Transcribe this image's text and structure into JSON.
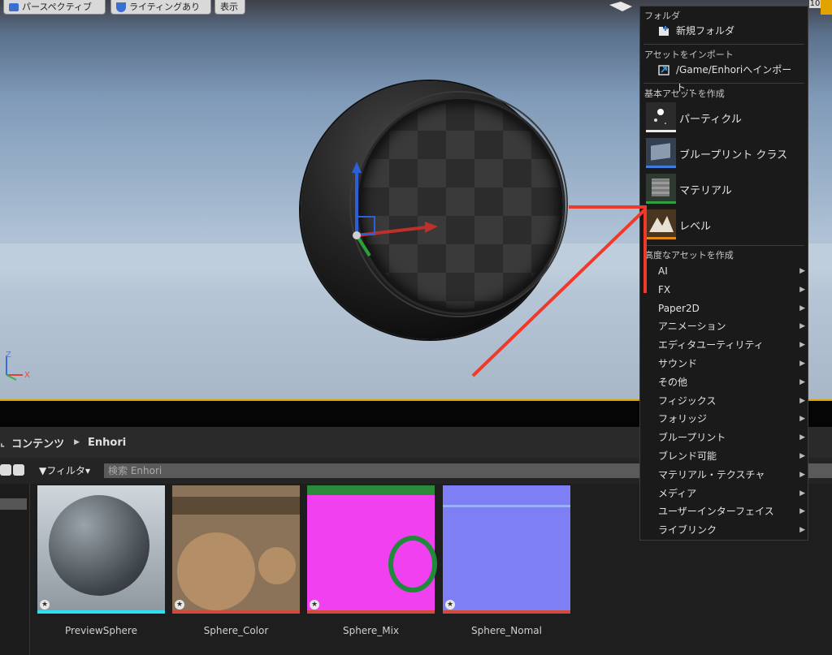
{
  "viewport": {
    "buttons": {
      "perspective": "パースペクティブ",
      "lighting": "ライティングあり",
      "show": "表示"
    },
    "axes": {
      "z": "Z",
      "x": "X"
    },
    "corner_number": "10"
  },
  "content_browser": {
    "breadcrumb": {
      "root": "コンテンツ",
      "folder": "Enhori"
    },
    "filter_label": "▼フィルタ▾",
    "search_placeholder": "検索 Enhori",
    "assets": [
      {
        "name": "PreviewSphere",
        "bar_color": "#2de0f0"
      },
      {
        "name": "Sphere_Color",
        "bar_color": "#d24a3a"
      },
      {
        "name": "Sphere_Mix",
        "bar_color": "#d24a3a"
      },
      {
        "name": "Sphere_Nomal",
        "bar_color": "#d24a3a"
      }
    ]
  },
  "menu": {
    "sections": {
      "folder": "フォルダ",
      "import": "アセットをインポート",
      "basic": "基本アセットを作成",
      "advanced": "高度なアセットを作成"
    },
    "new_folder": "新規フォルダ",
    "import_path": "/Game/Enhoriへインポート...",
    "basic_items": [
      {
        "label": "パーティクル",
        "bar_color": "#e8e8e8"
      },
      {
        "label": "ブループリント クラス",
        "bar_color": "#3b7fe0"
      },
      {
        "label": "マテリアル",
        "bar_color": "#2ea043"
      },
      {
        "label": "レベル",
        "bar_color": "#e08a1e"
      }
    ],
    "advanced_items": [
      "AI",
      "FX",
      "Paper2D",
      "アニメーション",
      "エディタユーティリティ",
      "サウンド",
      "その他",
      "フィジックス",
      "フォリッジ",
      "ブループリント",
      "ブレンド可能",
      "マテリアル・テクスチャ",
      "メディア",
      "ユーザーインターフェイス",
      "ライブリンク"
    ]
  },
  "colors": {
    "accent_border": "#d9a400",
    "annotation": "#f1392b"
  }
}
